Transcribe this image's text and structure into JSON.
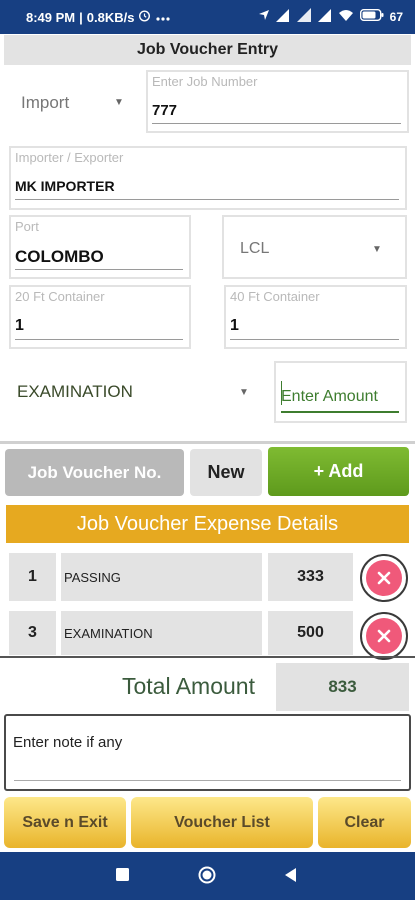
{
  "status_bar": {
    "time": "8:49 PM",
    "speed": "0.8KB/s",
    "battery": "67"
  },
  "title": "Job Voucher Entry",
  "import_export": {
    "selected": "Import"
  },
  "job_number": {
    "placeholder": "Enter Job Number",
    "value": "777"
  },
  "importer_exporter": {
    "label": "Importer / Exporter",
    "value": "MK IMPORTER"
  },
  "port": {
    "label": "Port",
    "value": "COLOMBO"
  },
  "load_type": {
    "selected": "LCL"
  },
  "container_20": {
    "label": "20 Ft Container",
    "value": "1"
  },
  "container_40": {
    "label": "40 Ft Container",
    "value": "1"
  },
  "expense_type": {
    "selected": "EXAMINATION"
  },
  "amount": {
    "placeholder": "Enter Amount"
  },
  "buttons": {
    "job_voucher_no": "Job Voucher No.",
    "new": "New",
    "add": "+ Add",
    "save_exit": "Save n Exit",
    "voucher_list": "Voucher List",
    "clear": "Clear"
  },
  "expense_header": "Job Voucher Expense Details",
  "expenses": [
    {
      "no": "1",
      "name": "PASSING",
      "amount": "333"
    },
    {
      "no": "3",
      "name": "EXAMINATION",
      "amount": "500"
    }
  ],
  "total": {
    "label": "Total Amount",
    "value": "833"
  },
  "note": {
    "placeholder": "Enter note if any"
  },
  "colors": {
    "status_bar": "#173f82",
    "accent_orange": "#e6a920",
    "add_green": "#6aa824",
    "delete_pink": "#f0597a",
    "total_text": "#3b5b3d"
  }
}
